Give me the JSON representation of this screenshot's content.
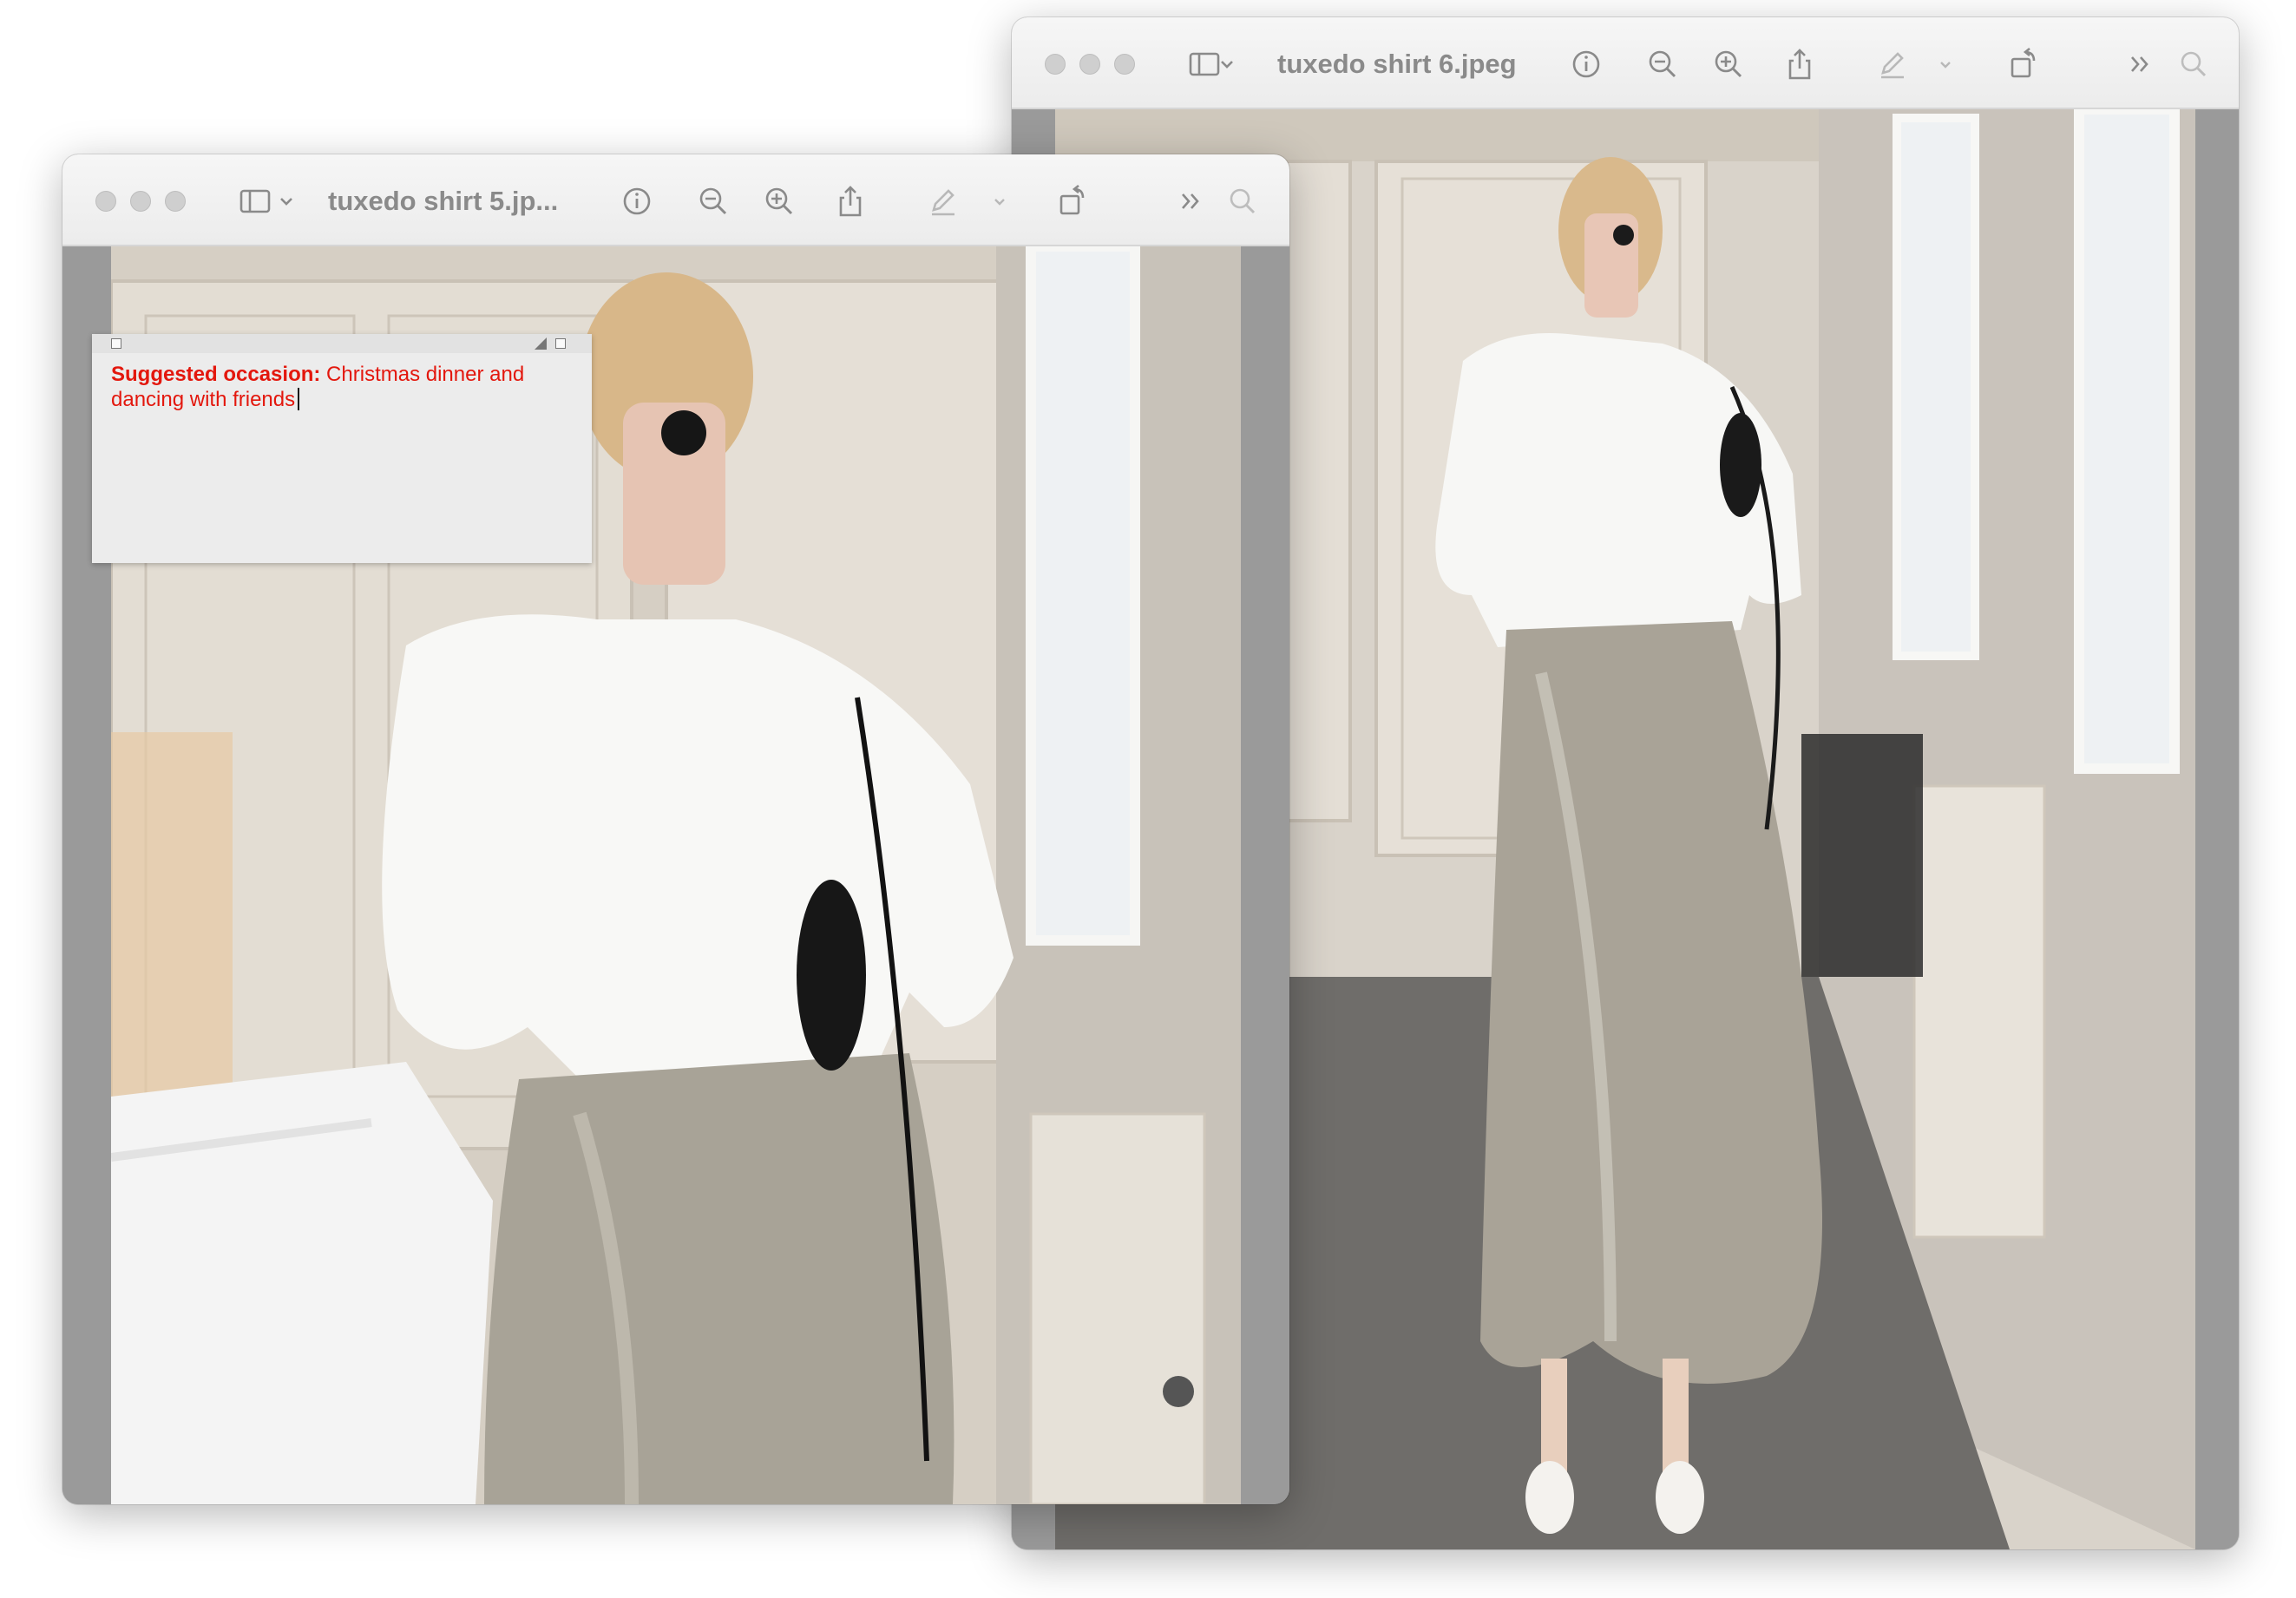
{
  "windows": [
    {
      "id": "back",
      "title": "tuxedo shirt 6.jpeg",
      "toolbar": [
        "sidebar-toggle-icon",
        "chevron-down-icon",
        "info-icon",
        "zoom-out-icon",
        "zoom-in-icon",
        "share-icon",
        "markup-pen-icon",
        "chevron-down-icon",
        "rotate-icon",
        "more-chevrons-icon",
        "search-icon"
      ]
    },
    {
      "id": "front",
      "title": "tuxedo shirt 5.jp...",
      "toolbar": [
        "sidebar-toggle-icon",
        "chevron-down-icon",
        "info-icon",
        "zoom-out-icon",
        "zoom-in-icon",
        "share-icon",
        "markup-pen-icon",
        "chevron-down-icon",
        "rotate-icon",
        "more-chevrons-icon",
        "search-icon"
      ]
    }
  ],
  "note": {
    "label": "Suggested occasion:",
    "text": " Christmas dinner and dancing with friends"
  },
  "colors": {
    "note_text": "#e3170d",
    "titlebar": "#ececec",
    "window_bg": "#9a9a9a"
  }
}
